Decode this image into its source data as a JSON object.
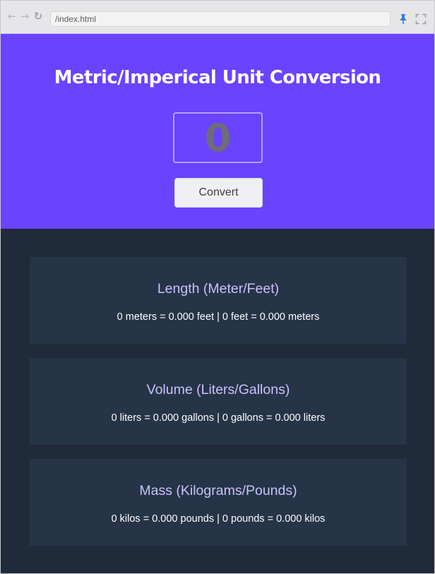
{
  "browser": {
    "url": "/index.html",
    "icons": {
      "back": "arrow-left-icon",
      "forward": "arrow-right-icon",
      "reload": "reload-icon",
      "pin": "pin-icon",
      "expand": "fullscreen-icon"
    }
  },
  "header": {
    "title": "Metric/Imperical Unit Conversion",
    "input_value": "0",
    "convert_label": "Convert"
  },
  "cards": [
    {
      "title": "Length (Meter/Feet)",
      "result": "0 meters = 0.000 feet | 0 feet = 0.000 meters"
    },
    {
      "title": "Volume (Liters/Gallons)",
      "result": "0 liters = 0.000 gallons | 0 gallons = 0.000 liters"
    },
    {
      "title": "Mass (Kilograms/Pounds)",
      "result": "0 kilos = 0.000 pounds | 0 pounds = 0.000 kilos"
    }
  ],
  "colors": {
    "hero_bg": "#6943ff",
    "page_bg": "#1f2a3a",
    "card_bg": "#253447",
    "card_title": "#ccc1ff",
    "text": "#ffffff",
    "pin_accent": "#2f7de1"
  }
}
